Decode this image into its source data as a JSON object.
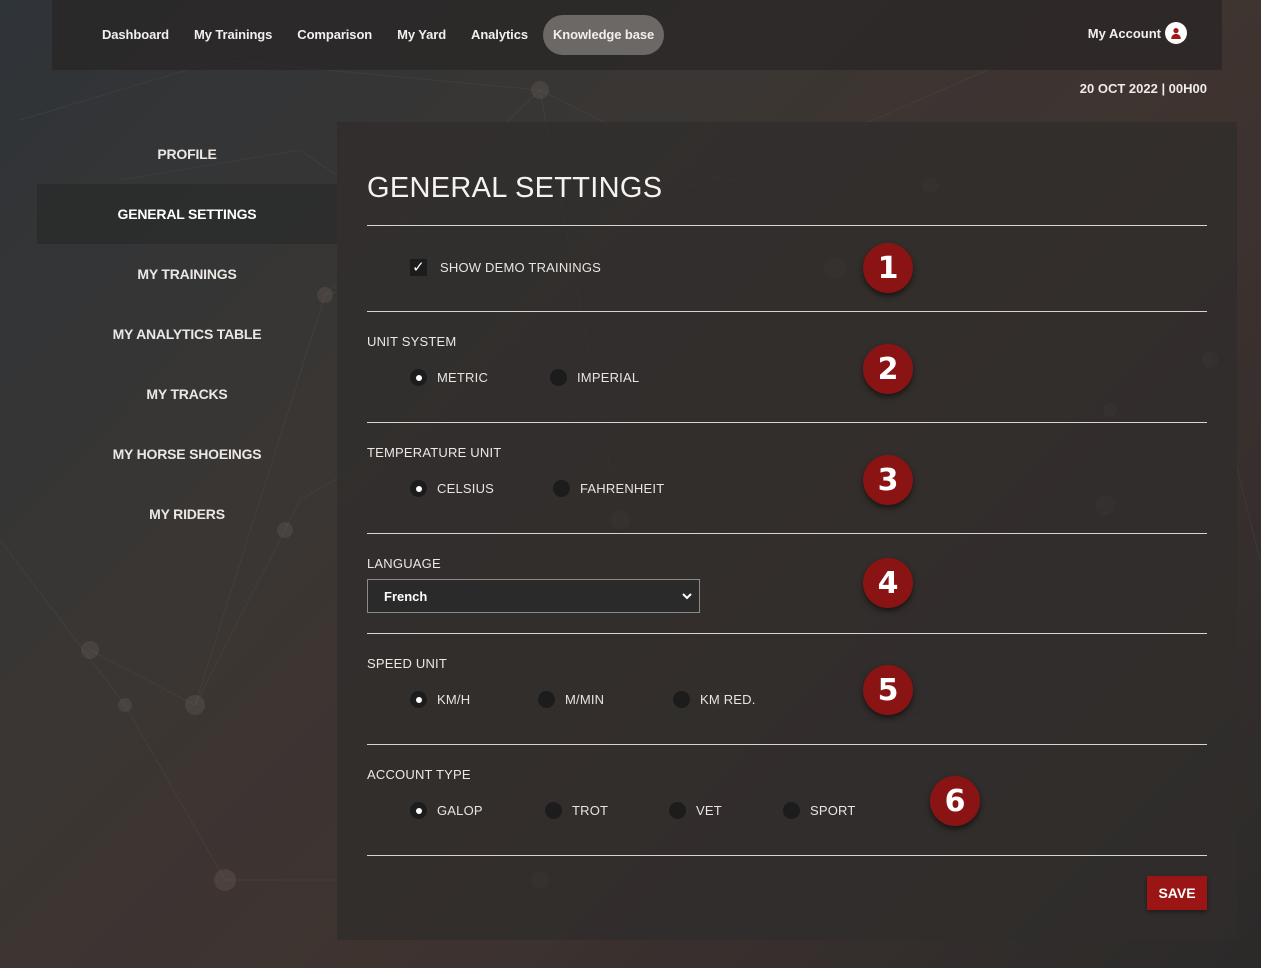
{
  "nav": {
    "items": [
      {
        "label": "Dashboard"
      },
      {
        "label": "My Trainings"
      },
      {
        "label": "Comparison"
      },
      {
        "label": "My Yard"
      },
      {
        "label": "Analytics"
      },
      {
        "label": "Knowledge base"
      }
    ],
    "active": "Knowledge base",
    "account_label": "My Account"
  },
  "datetime": "20 OCT 2022 | 00H00",
  "sidebar": {
    "items": [
      {
        "label": "PROFILE"
      },
      {
        "label": "GENERAL SETTINGS"
      },
      {
        "label": "MY TRAININGS"
      },
      {
        "label": "MY ANALYTICS TABLE"
      },
      {
        "label": "MY TRACKS"
      },
      {
        "label": "MY HORSE SHOEINGS"
      },
      {
        "label": "MY RIDERS"
      }
    ],
    "active": "GENERAL SETTINGS"
  },
  "settings": {
    "title": "GENERAL SETTINGS",
    "demo": {
      "label": "SHOW DEMO TRAININGS",
      "checked": true,
      "check_glyph": "✓"
    },
    "unit_system": {
      "label": "UNIT SYSTEM",
      "options": [
        "METRIC",
        "IMPERIAL"
      ],
      "selected": "METRIC"
    },
    "temperature": {
      "label": "TEMPERATURE UNIT",
      "options": [
        "CELSIUS",
        "FAHRENHEIT"
      ],
      "selected": "CELSIUS"
    },
    "language": {
      "label": "LANGUAGE",
      "value": "French"
    },
    "speed": {
      "label": "SPEED UNIT",
      "options": [
        "KM/H",
        "M/MIN",
        "KM RED."
      ],
      "selected": "KM/H"
    },
    "account_type": {
      "label": "ACCOUNT TYPE",
      "options": [
        "GALOP",
        "TROT",
        "VET",
        "SPORT"
      ],
      "selected": "GALOP"
    },
    "save_label": "SAVE"
  },
  "badges": [
    "1",
    "2",
    "3",
    "4",
    "5",
    "6"
  ],
  "colors": {
    "accent": "#9b1515",
    "badge": "#8a1414",
    "active_nav": "#6b6866"
  }
}
